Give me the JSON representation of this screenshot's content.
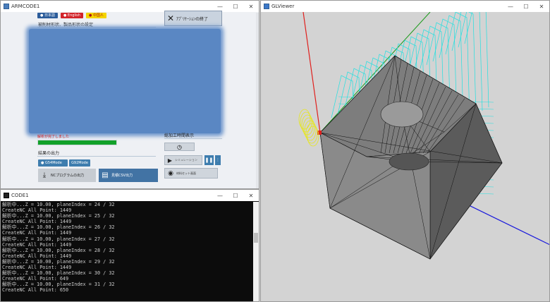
{
  "armcode": {
    "title": "ARMCODE1",
    "lang_buttons": [
      "● 日本語",
      "● English",
      "● 中国人"
    ],
    "section_material": "被削材形状、製品形状の設定",
    "exit_label": "ｱﾌﾟﾘｹｰｼｮﾝの終了",
    "analysis_status": "解析が完了しました",
    "progress_percent": 100,
    "section_output": "結果の出力",
    "mode_g54": "● G54Mode",
    "mode_g92": "G92Mode",
    "nc_output_label": "NCプログラムの出力",
    "csv_output_label": "見積CSV出力",
    "right_label": "総加工時間表示",
    "sim_label": "シミュレーション",
    "model_label": "材料セット画面",
    "colors": {
      "accent": "#3e7dae",
      "progress": "#12a12a",
      "status": "#d62020"
    }
  },
  "code1": {
    "title": "CODE1",
    "lines": [
      "解析中...Z = 10.00, planeIndex = 24 / 32",
      "CreateNC All Point: 1449",
      "解析中...Z = 10.00, planeIndex = 25 / 32",
      "CreateNC All Point: 1449",
      "解析中...Z = 10.00, planeIndex = 26 / 32",
      "CreateNC All Point: 1449",
      "解析中...Z = 10.00, planeIndex = 27 / 32",
      "CreateNC All Point: 1449",
      "解析中...Z = 10.00, planeIndex = 28 / 32",
      "CreateNC All Point: 1449",
      "解析中...Z = 10.00, planeIndex = 29 / 32",
      "CreateNC All Point: 1449",
      "解析中...Z = 10.00, planeIndex = 30 / 32",
      "CreateNC All Point: 649",
      "解析中...Z = 10.00, planeIndex = 31 / 32",
      "CreateNC All Point: 650"
    ]
  },
  "glviewer": {
    "title": "GLViewer",
    "colors": {
      "x_axis": "#e0201e",
      "y_axis": "#1a9a1a",
      "z_axis": "#1a1adc",
      "toolpath": "#22e0e0",
      "tool": "#e6e620",
      "solid": "#6e6e6e"
    }
  },
  "window_controls": {
    "minimize": "—",
    "maximize": "☐",
    "close": "✕"
  }
}
